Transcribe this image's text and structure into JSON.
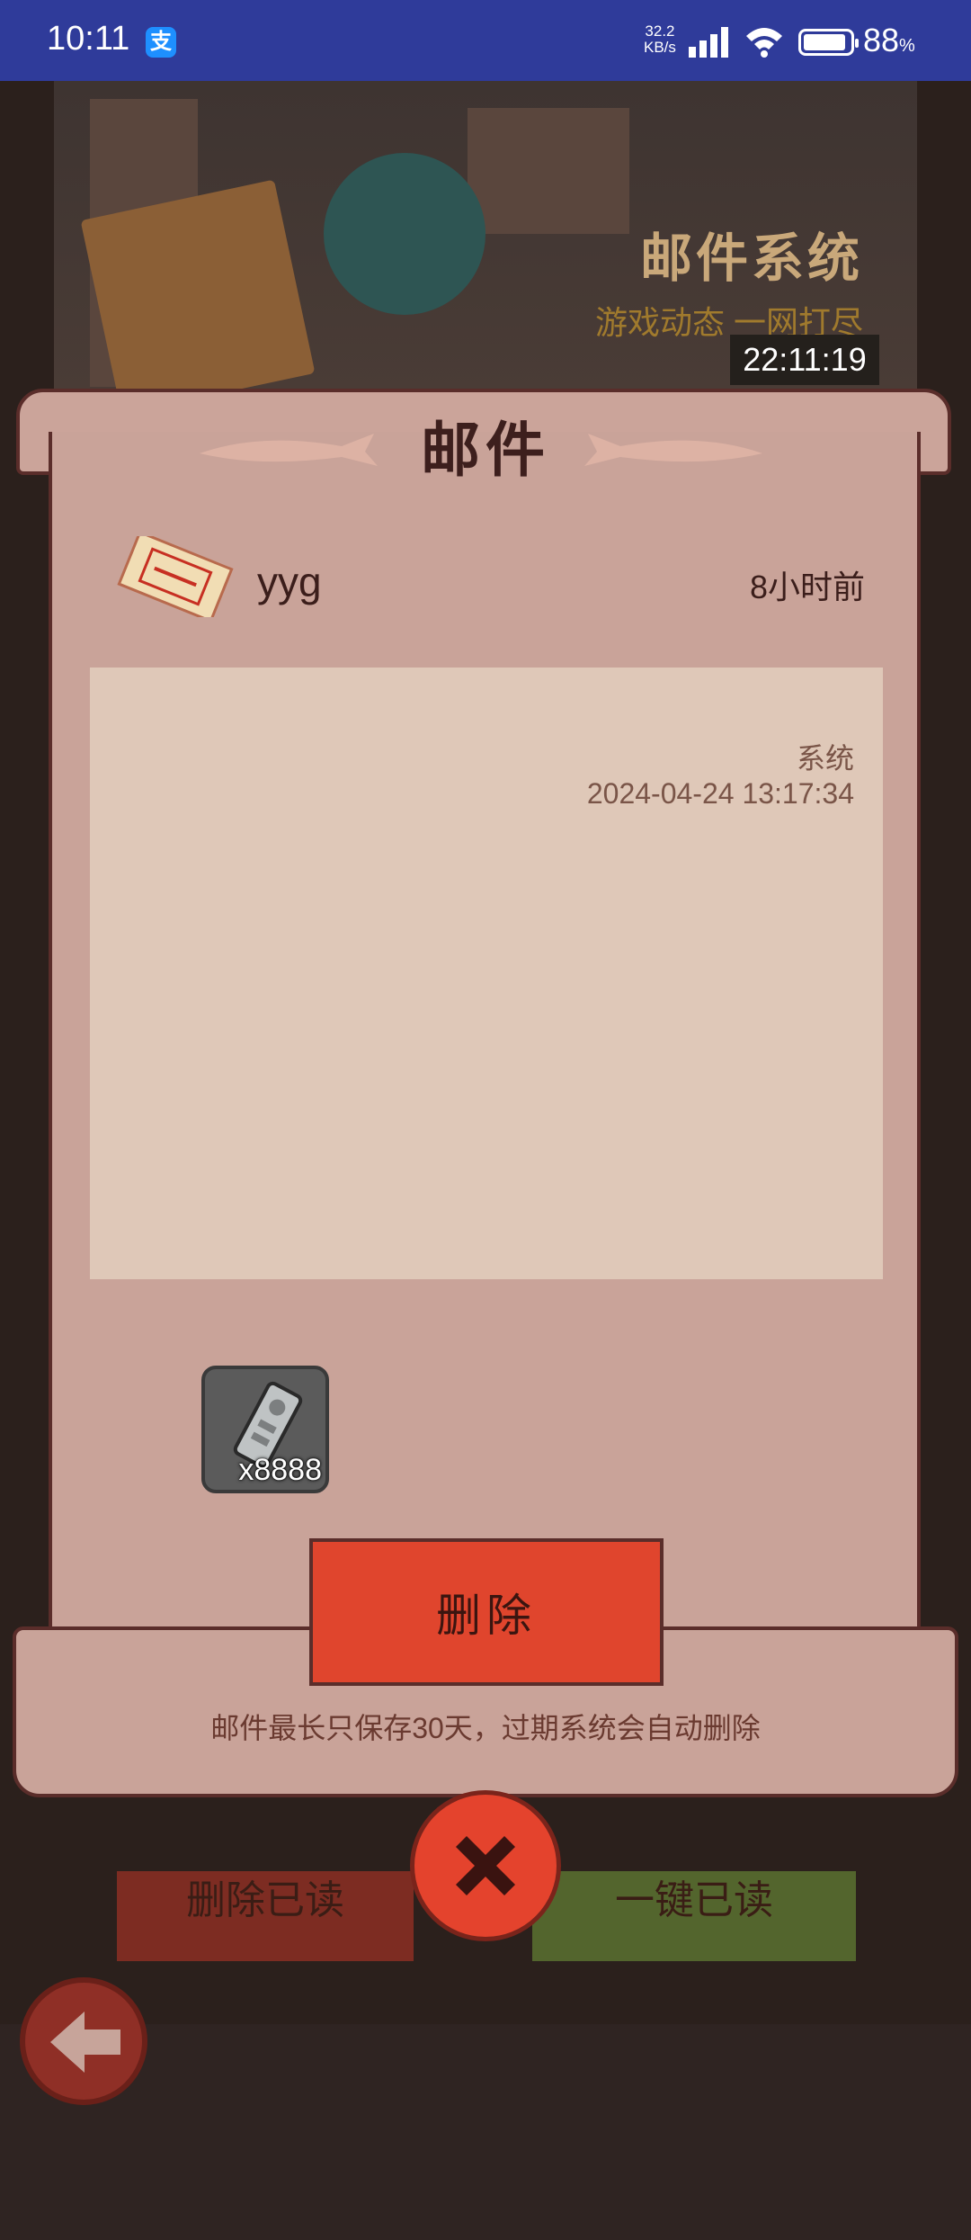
{
  "status_bar": {
    "time": "10:11",
    "app_badge": "支",
    "network_speed_value": "32.2",
    "network_speed_unit": "KB/s",
    "battery": "88",
    "battery_unit": "%"
  },
  "banner": {
    "title": "邮件系统",
    "subtitle": "游戏动态 一网打尽",
    "clock": "22:11:19"
  },
  "mail": {
    "panel_title": "邮件",
    "sender": "yyg",
    "received": "8小时前",
    "content_from": "系统",
    "content_date": "2024-04-24 13:17:34",
    "attachment": {
      "icon": "reward-item-icon",
      "count": "x8888"
    },
    "delete_label": "删除",
    "notice": "邮件最长只保存30天，过期系统会自动删除"
  },
  "underlay": {
    "delete_read_label": "删除已读",
    "mark_all_read_label": "一键已读"
  },
  "colors": {
    "status_bar": "#2f3b9a",
    "panel": "#c9a399",
    "content_box": "#dfc8b8",
    "delete_button": "#e0452d",
    "close_button": "#e4432d"
  }
}
